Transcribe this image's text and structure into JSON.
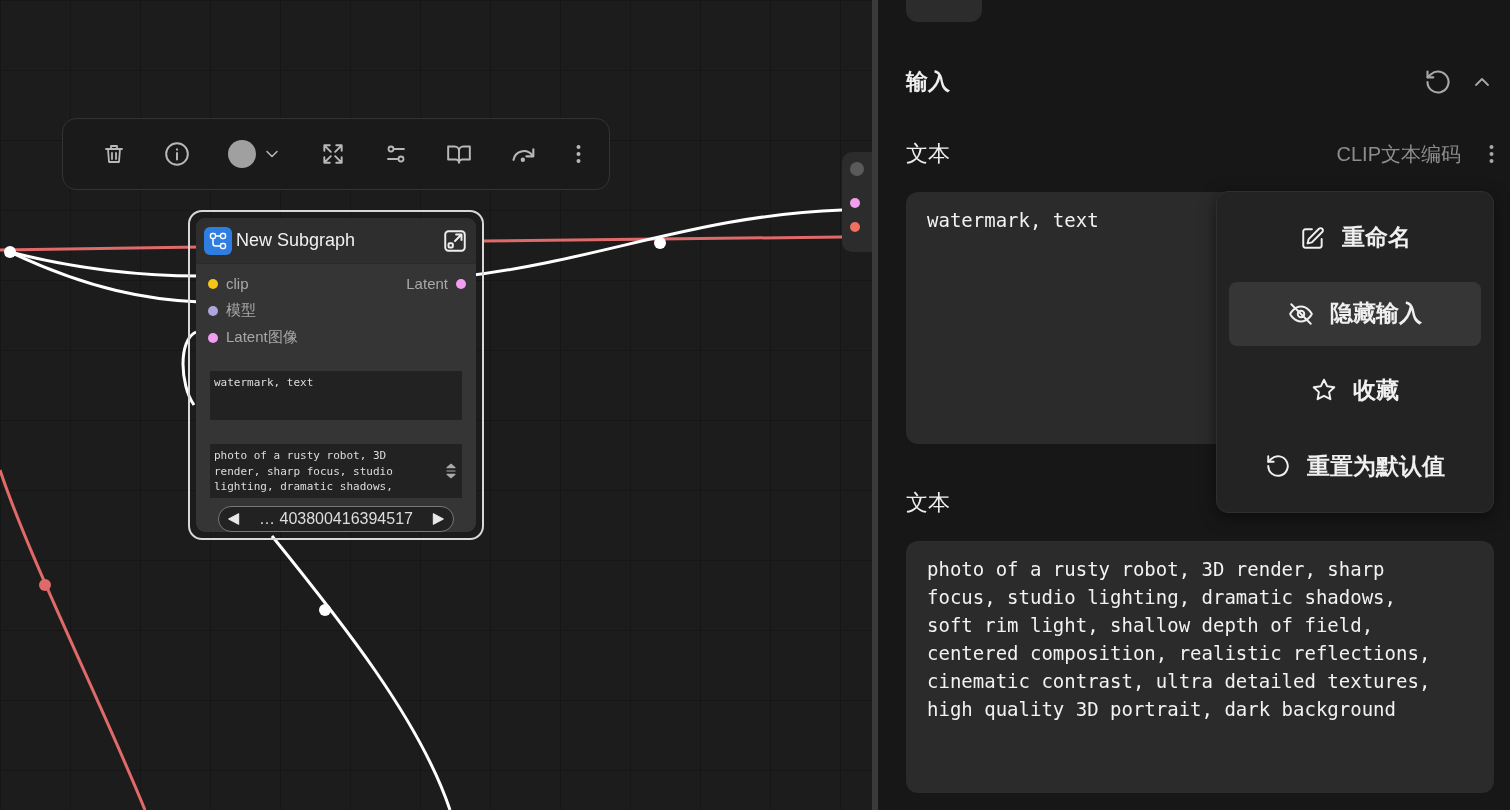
{
  "canvas": {
    "node": {
      "title": "New Subgraph",
      "inputs": [
        {
          "label": "clip",
          "color": "#f5c518"
        },
        {
          "label": "模型",
          "color": "#b0a4dc"
        },
        {
          "label": "Latent图像",
          "color": "#f29ef0"
        }
      ],
      "outputs": [
        {
          "label": "Latent",
          "color": "#f29ef0"
        }
      ],
      "negative_text": "watermark, text",
      "positive_text": "photo of a rusty robot, 3D render, sharp focus, studio lighting, dramatic shadows,",
      "seed": "… 403800416394517"
    },
    "side_node": {
      "slots": [
        {
          "color": "#f29ef0"
        },
        {
          "color": "#f07060"
        }
      ]
    }
  },
  "panel": {
    "section": {
      "title": "输入",
      "expanded": true
    },
    "params": [
      {
        "label": "文本",
        "source": "CLIP文本编码",
        "value": "watermark, text"
      },
      {
        "label": "文本",
        "value": "photo of a rusty robot, 3D render, sharp focus, studio lighting, dramatic shadows, soft rim light, shallow depth of field, centered composition, realistic reflections, cinematic contrast, ultra detailed textures, high quality 3D portrait, dark background"
      }
    ],
    "menu": [
      {
        "kind": "edit",
        "label": "重命名",
        "selected": false
      },
      {
        "kind": "hide",
        "label": "隐藏输入",
        "selected": true
      },
      {
        "kind": "star",
        "label": "收藏",
        "selected": false
      },
      {
        "kind": "reset",
        "label": "重置为默认值",
        "selected": false
      }
    ]
  }
}
